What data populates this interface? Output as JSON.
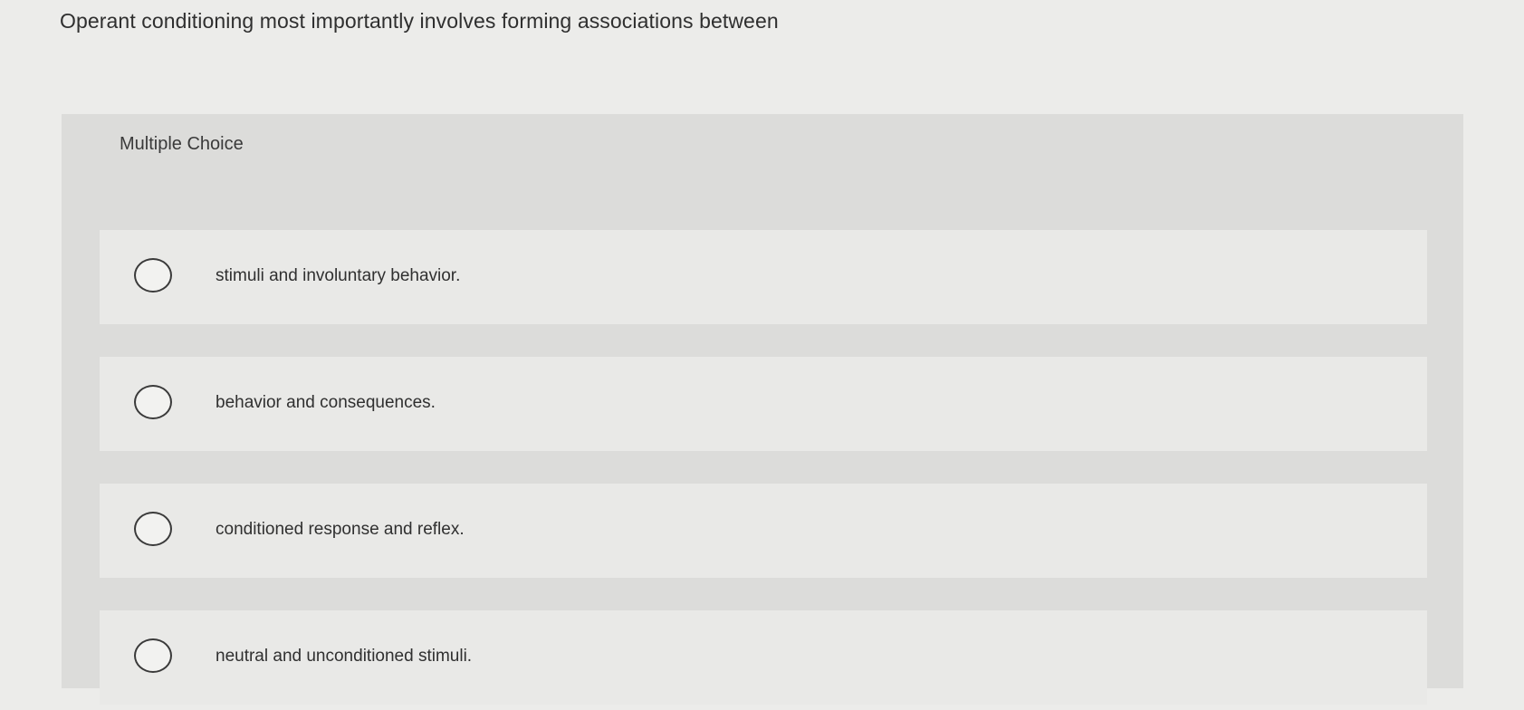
{
  "question": {
    "text": "Operant conditioning most importantly involves forming associations between"
  },
  "panel": {
    "header": "Multiple Choice"
  },
  "choices": [
    {
      "label": "stimuli and involuntary behavior."
    },
    {
      "label": "behavior and consequences."
    },
    {
      "label": "conditioned response and reflex."
    },
    {
      "label": "neutral and unconditioned stimuli."
    }
  ]
}
